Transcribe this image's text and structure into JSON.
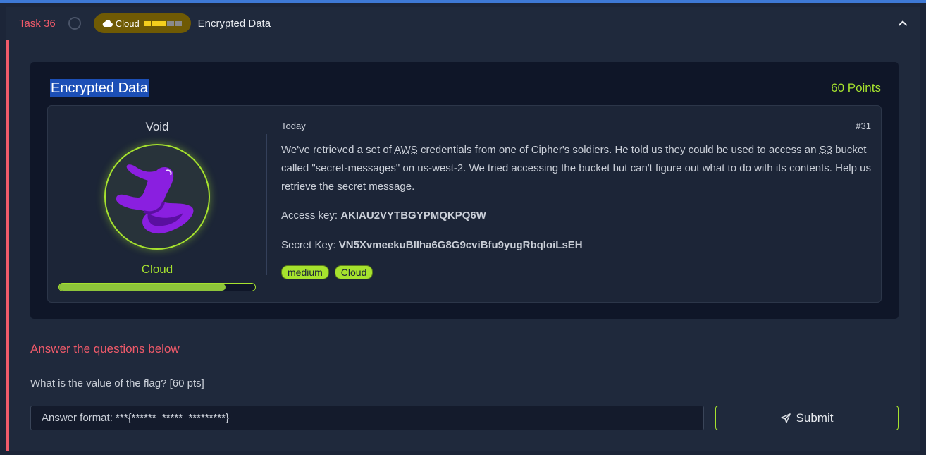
{
  "task": {
    "label": "Task 36",
    "category": "Cloud",
    "difficulty_level": 3,
    "difficulty_max": 5,
    "title": "Encrypted Data",
    "collapse_icon": "chevron-up-icon"
  },
  "card": {
    "title": "Encrypted Data",
    "points": "60 Points",
    "author": "Void",
    "role": "Cloud",
    "progress": 0.85,
    "date": "Today",
    "issue": "#31",
    "description": {
      "p1": "We've retrieved a set of ",
      "abbr1": "AWS",
      "p2": " credentials from one of Cipher's soldiers. He told us they could be used to access an ",
      "abbr2": "S3",
      "p3": " bucket called \"secret-messages\" on us-west-2. We tried accessing the bucket but can't figure out what to do with its contents. Help us retrieve the secret message."
    },
    "access_key_label": "Access key: ",
    "access_key": "AKIAU2VYTBGYPMQKPQ6W",
    "secret_key_label": "Secret Key: ",
    "secret_key": "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",
    "tags": [
      "medium",
      "Cloud"
    ]
  },
  "answers": {
    "heading": "Answer the questions below",
    "question": "What is the value of the flag? [60 pts]",
    "input_value": "",
    "input_placeholder": "Answer format: ***{******_*****_*********}",
    "submit_label": "Submit",
    "submit_icon": "send-icon"
  },
  "colors": {
    "accent_red": "#f05a6a",
    "accent_green": "#a6e22e",
    "badge_gold": "#6f5a04"
  }
}
